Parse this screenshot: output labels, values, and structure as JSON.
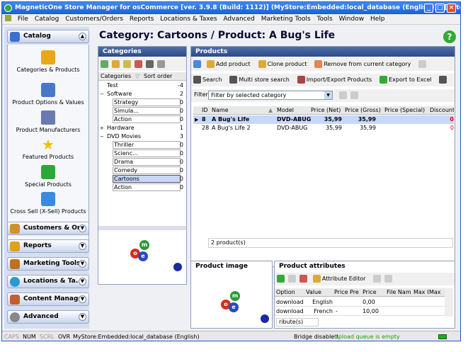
{
  "window": {
    "title": "MagneticOne Store Manager for osCommerce [ver. 3.9.8 (Build: 1112)] (MyStore:Embedded:local_database (English)) - [Catego"
  },
  "menu": [
    "File",
    "Catalog",
    "Customers/Orders",
    "Reports",
    "Locations & Taxes",
    "Advanced",
    "Marketing Tools",
    "Tools",
    "Window",
    "Help"
  ],
  "sidebar": {
    "catalog_label": "Catalog",
    "catalog_items": [
      "Categories & Products",
      "Product Options & Values",
      "Product Manufacturers",
      "Featured Products",
      "Special Products",
      "Cross Sell (X-Sell) Products"
    ],
    "sections": [
      "Customers & Or...",
      "Reports",
      "Marketing Tools",
      "Locations & Ta...",
      "Content Manager",
      "Advanced"
    ]
  },
  "main": {
    "title": "Category: Cartoons / Product: A Bug's Life"
  },
  "categories": {
    "title": "Categories",
    "col_name": "Categories",
    "col_sort": "Sort order",
    "rows": [
      {
        "name": "Test",
        "value": "-4",
        "indent": 0,
        "expander": ""
      },
      {
        "name": "Software",
        "value": "2",
        "indent": 0,
        "expander": "−"
      },
      {
        "name": "Strategy",
        "value": "0",
        "indent": 1,
        "expander": ""
      },
      {
        "name": "Simula...",
        "value": "0",
        "indent": 1,
        "expander": ""
      },
      {
        "name": "Action",
        "value": "0",
        "indent": 1,
        "expander": ""
      },
      {
        "name": "Hardware",
        "value": "1",
        "indent": 0,
        "expander": "+"
      },
      {
        "name": "DVD Movies",
        "value": "3",
        "indent": 0,
        "expander": "−"
      },
      {
        "name": "Thriller",
        "value": "0",
        "indent": 1,
        "expander": ""
      },
      {
        "name": "Scienc...",
        "value": "0",
        "indent": 1,
        "expander": ""
      },
      {
        "name": "Drama",
        "value": "0",
        "indent": 1,
        "expander": ""
      },
      {
        "name": "Comedy",
        "value": "0",
        "indent": 1,
        "expander": ""
      },
      {
        "name": "Cartoons",
        "value": "0",
        "indent": 1,
        "expander": ""
      },
      {
        "name": "Action",
        "value": "0",
        "indent": 1,
        "expander": ""
      }
    ]
  },
  "products": {
    "title": "Products",
    "toolbar1": {
      "add": "Add product",
      "clone": "Clone product",
      "remove": "Remove from current category"
    },
    "toolbar2": {
      "search": "Search",
      "multi": "Multi store search",
      "import": "Import/Export Products",
      "excel": "Export to Excel"
    },
    "filter_label": "Filter",
    "filter_value": "Filter by selected category",
    "columns": [
      "ID",
      "Name",
      "Model",
      "Price (Net)",
      "Price (Gross)",
      "Price (Special)",
      "Discount"
    ],
    "rows": [
      {
        "id": "8",
        "name": "A Bug's Life",
        "model": "DVD-ABUG",
        "net": "35,99",
        "gross": "35,99",
        "special": "",
        "discount": "0"
      },
      {
        "id": "28",
        "name": "A Bug's Life 2",
        "model": "DVD-ABUG",
        "net": "35,99",
        "gross": "35,99",
        "special": "",
        "discount": "0"
      }
    ],
    "count": "2 product(s)"
  },
  "image_panel": {
    "title": "Product image"
  },
  "attributes": {
    "title": "Product attributes",
    "editor": "Attribute Editor",
    "columns": [
      "Option",
      "Value",
      "Price Pre",
      "Price",
      "File Nam",
      "Max I",
      "Max"
    ],
    "rows": [
      {
        "option": "download",
        "value": "English",
        "prefix": "",
        "price": "0,00"
      },
      {
        "option": "download",
        "value": "French",
        "prefix": "-",
        "price": "10,00"
      }
    ],
    "footer": "ribute(s)"
  },
  "statusbar": {
    "caps": "CAPS",
    "num": "NUM",
    "scrl": "SCRL",
    "ovr": "OVR",
    "store": "MyStore:Embedded:local_database (English)",
    "bridge": "Bridge disabled.",
    "queue": "Upload queue is empty"
  },
  "colors": {
    "selected_row": "#c8d8f8",
    "sidebar_bg": "#d6dff0",
    "panel_header": "#3a5a96",
    "queue_green": "#1a9a1a"
  }
}
